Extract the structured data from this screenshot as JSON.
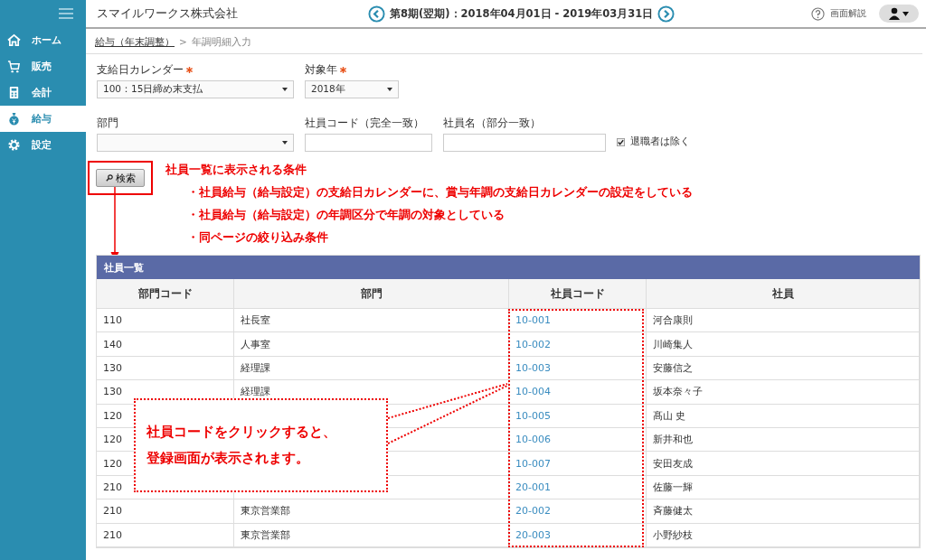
{
  "sidebar": {
    "items": [
      {
        "label": "ホーム",
        "kind": "home",
        "selected": false
      },
      {
        "label": "販売",
        "kind": "cart",
        "selected": false
      },
      {
        "label": "会計",
        "kind": "calculator",
        "selected": false
      },
      {
        "label": "給与",
        "kind": "moneybag",
        "selected": true
      },
      {
        "label": "設定",
        "kind": "gear",
        "selected": false
      }
    ]
  },
  "header": {
    "company": "スマイルワークス株式会社",
    "period": "第8期(翌期)：2018年04月01日 - 2019年03月31日",
    "help": "画面解説"
  },
  "breadcrumb": {
    "link": "給与（年末調整）",
    "separator": ">",
    "current": "年調明細入力"
  },
  "filters": [
    {
      "kind": "select",
      "label": "支給日カレンダー",
      "required": true,
      "value": "100：15日締め末支払"
    },
    {
      "kind": "select",
      "label": "対象年",
      "required": true,
      "value": "2018年"
    },
    {
      "kind": "select",
      "label": "部門",
      "required": false
    },
    {
      "kind": "text",
      "label": "社員コード（完全一致）",
      "required": false
    },
    {
      "kind": "text",
      "label": "社員名（部分一致）",
      "required": false
    },
    {
      "kind": "checkbox",
      "label": "退職者は除く",
      "checked": true
    }
  ],
  "search_button": "検索",
  "annotation": {
    "title": "社員一覧に表示される条件",
    "items": [
      "・社員給与（給与設定）の支給日カレンダーに、賞与年調の支給日カレンダーの設定をしている",
      "・社員給与（給与設定）の年調区分で年調の対象としている",
      "・同ページの絞り込み条件"
    ]
  },
  "table": {
    "title": "社員一覧",
    "columns": [
      "部門コード",
      "部門",
      "社員コード",
      "社員"
    ],
    "rows": [
      [
        "110",
        "社長室",
        "10-001",
        "河合康則"
      ],
      [
        "140",
        "人事室",
        "10-002",
        "川崎集人"
      ],
      [
        "130",
        "経理課",
        "10-003",
        "安藤信之"
      ],
      [
        "130",
        "経理課",
        "10-004",
        "坂本奈々子"
      ],
      [
        "120",
        "",
        "10-005",
        "髙山 史"
      ],
      [
        "120",
        "",
        "10-006",
        "新井和也"
      ],
      [
        "120",
        "",
        "10-007",
        "安田友成"
      ],
      [
        "210",
        "",
        "20-001",
        "佐藤一輝"
      ],
      [
        "210",
        "東京営業部",
        "20-002",
        "斉藤健太"
      ],
      [
        "210",
        "東京営業部",
        "20-003",
        "小野紗枝"
      ]
    ]
  },
  "callout": {
    "lines": [
      "社員コードをクリックすると、",
      "登録画面が表示されます。"
    ]
  }
}
